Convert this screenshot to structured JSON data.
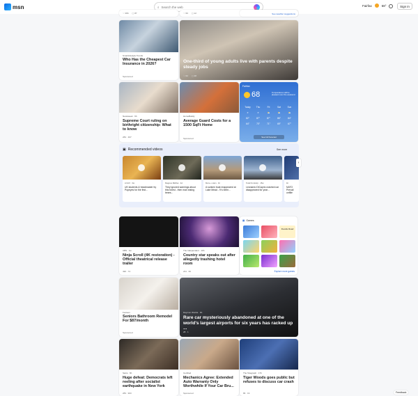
{
  "header": {
    "brand": "msn",
    "search_placeholder": "Search the web",
    "location": "Fairfax",
    "temp": "68°",
    "signin": "Sign in"
  },
  "topstrip": {
    "see_suggestions": "See weather suggestions"
  },
  "cards": {
    "c1": {
      "src": "SmartLifestyle Trends",
      "title": "Who Has the Cheapest Car Insurance in 2026?",
      "sponsored": "Sponsored"
    },
    "c2": {
      "title": "One-third of young adults live with parents despite steady jobs"
    },
    "c3": {
      "src": "Newsweek · 9h",
      "title": "Supreme Court ruling on birthright citizenship: What to know",
      "meta": "284 · 307"
    },
    "c4": {
      "src": "HomeBuddy",
      "title": "Average Guard Costs for a 1500 SqFt Home",
      "sponsored": "Sponsored"
    },
    "c5": {
      "src": "CBS · 1w",
      "title": "Ninja Scroll (4K restoration) - Official theatrical release trailer",
      "meta": "490 · 74"
    },
    "c6": {
      "src": "The Independent · 10h",
      "title": "Country star speaks out after allegedly trashing hotel room",
      "meta": "231 · 60"
    },
    "c7": {
      "src": "Festoon",
      "title": "Seniors Bathroom Remodel For $87/month",
      "sponsored": "Sponsored"
    },
    "c8": {
      "src": "Daymon Worlds · 6h",
      "title": "Rare car mysteriously abandoned at one of the world's largest airports for six years has racked up ...",
      "meta": "28 · 1"
    },
    "c9": {
      "src": "Sarra · 6h",
      "title": "Huge defeat: Democrats left reeling after socialist earthquake in New York",
      "meta": "283 · 903"
    },
    "c10": {
      "src": "Certified",
      "title": "Mechanics Agree: Extended Auto Warranty Only Worthwhile If Your Car Bru...",
      "sponsored": "Sponsored"
    },
    "c11": {
      "src": "The Telegraph · 17h",
      "title": "Tiger Woods goes public but refuses to discuss car crash",
      "meta": "86 · 19"
    }
  },
  "weather": {
    "city": "Fairfax",
    "temp": "68",
    "note": "Temperatures will be pleasant over the weekend",
    "days": [
      "Today",
      "Thu",
      "Fri",
      "Sat",
      "Sun"
    ],
    "hi": [
      "82°",
      "87°",
      "87°",
      "86°",
      "84°"
    ],
    "lo": [
      "64°",
      "70°",
      "71°",
      "69°",
      "67°"
    ],
    "link": "See full forecast"
  },
  "videos": {
    "title": "Recommended videos",
    "see_more": "See more",
    "items": [
      {
        "src": "LOLIX · 3w",
        "title": "UK students & headmaster try Popeyes for the first..."
      },
      {
        "src": "Magnus Midtbø · 4d",
        "title": "They ignored warnings about this forest - then man eating bears..."
      },
      {
        "src": "More + Ham · 1h",
        "title": "A sunken boat reappeared at Lake Mead - 'It's been..."
      },
      {
        "src": "Total Frontstrp · 15w",
        "title": "Leonardo DiCaprio crashed car disappeared for year..."
      },
      {
        "src": "1b",
        "title": "NATO Prevail unfille"
      }
    ]
  },
  "games": {
    "title": "Games",
    "tiles": [
      "Doodle Road"
    ],
    "link": "Explore more games"
  },
  "feedback": "Feedback"
}
